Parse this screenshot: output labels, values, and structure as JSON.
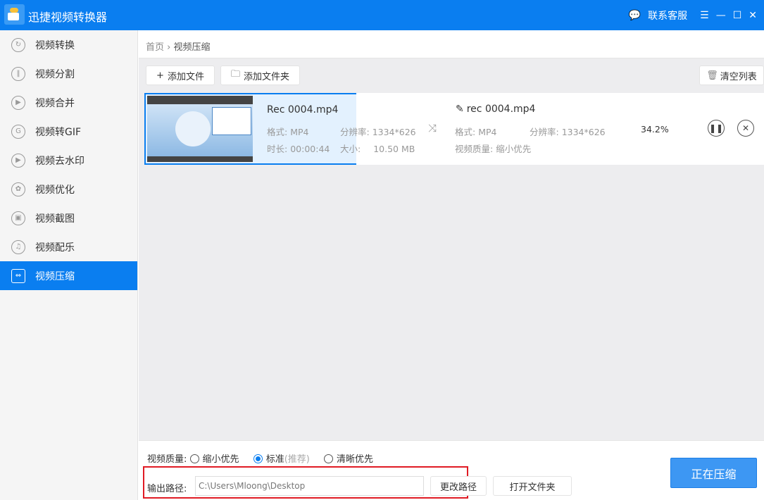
{
  "app": {
    "title": "迅捷视频转换器",
    "support": "联系客服"
  },
  "sidebar": {
    "items": [
      {
        "label": "视频转换",
        "icon": "↻"
      },
      {
        "label": "视频分割",
        "icon": "‖"
      },
      {
        "label": "视频合并",
        "icon": "▶"
      },
      {
        "label": "视频转GIF",
        "icon": "G"
      },
      {
        "label": "视频去水印",
        "icon": "▶"
      },
      {
        "label": "视频优化",
        "icon": "✿"
      },
      {
        "label": "视频截图",
        "icon": "▣"
      },
      {
        "label": "视频配乐",
        "icon": "♫"
      },
      {
        "label": "视频压缩",
        "icon": "⇔"
      }
    ]
  },
  "breadcrumb": {
    "home": "首页",
    "sep": "›",
    "current": "视频压缩"
  },
  "toolbar": {
    "add_file": "添加文件",
    "add_folder": "添加文件夹",
    "clear": "清空列表"
  },
  "file": {
    "name": "Rec 0004.mp4",
    "format_label": "格式:",
    "format": "MP4",
    "res_label": "分辨率:",
    "resolution": "1334*626",
    "dur_label": "时长:",
    "duration": "00:00:44",
    "size_label": "大小:",
    "size": "10.50 MB",
    "out_name": "rec 0004.mp4",
    "out_format": "MP4",
    "out_resolution": "1334*626",
    "quality_label": "视频质量:",
    "out_quality": "缩小优先",
    "progress": "34.2%"
  },
  "bottom": {
    "quality_label": "视频质量:",
    "options": [
      "缩小优先",
      "标准",
      "清晰优先"
    ],
    "recommend": "(推荐)",
    "selected": "标准",
    "output_label": "输出路径:",
    "path": "C:\\Users\\Mloong\\Desktop",
    "change": "更改路径",
    "open": "打开文件夹",
    "start": "正在压缩"
  },
  "colors": {
    "accent": "#0a7ef0",
    "highlight": "#e01b24"
  }
}
